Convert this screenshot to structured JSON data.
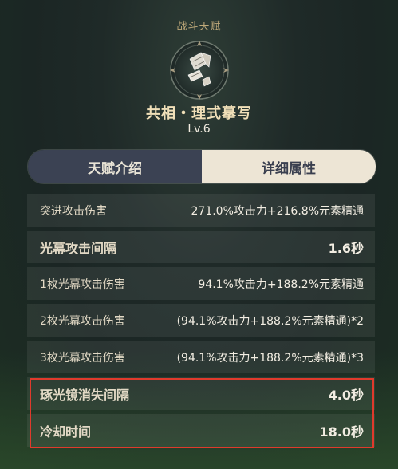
{
  "header": {
    "category": "战斗天赋",
    "title": "共相・理式摹写",
    "level": "Lv.6",
    "icon": "talent-emblem-icon"
  },
  "tabs": [
    {
      "label": "天赋介绍",
      "active": false
    },
    {
      "label": "详细属性",
      "active": true
    }
  ],
  "attributes": [
    {
      "label": "突进攻击伤害",
      "value": "271.0%攻击力+216.8%元素精通"
    },
    {
      "label": "光幕攻击间隔",
      "value": "1.6秒"
    },
    {
      "label": "1枚光幕攻击伤害",
      "value": "94.1%攻击力+188.2%元素精通"
    },
    {
      "label": "2枚光幕攻击伤害",
      "value": "(94.1%攻击力+188.2%元素精通)*2"
    },
    {
      "label": "3枚光幕攻击伤害",
      "value": "(94.1%攻击力+188.2%元素精通)*3"
    },
    {
      "label": "琢光镜消失间隔",
      "value": "4.0秒"
    },
    {
      "label": "冷却时间",
      "value": "18.0秒"
    }
  ],
  "colors": {
    "highlight_border": "#e03a2c",
    "title": "#f0dfb8",
    "tab_active_bg": "#ede5d5",
    "tab_inactive_bg": "#3b4253"
  }
}
